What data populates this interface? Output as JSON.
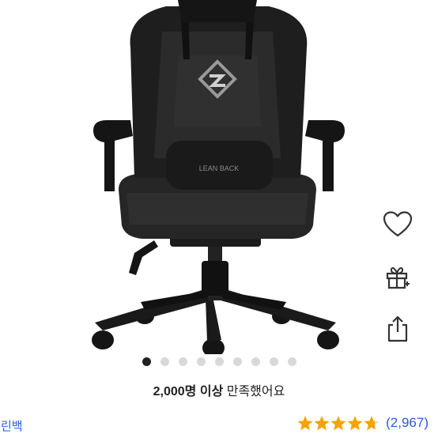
{
  "product": {
    "image_alt": "Leanback gaming chair",
    "chair_logo_text": "LEAN BACK"
  },
  "actions": {
    "wishlist_icon": "heart-icon",
    "gift_icon": "gift-icon",
    "share_icon": "share-icon"
  },
  "carousel": {
    "total": 9,
    "active_index": 0
  },
  "satisfaction": {
    "count": "2,000명 이상",
    "text": " 만족했어요"
  },
  "brand": {
    "name": "린백"
  },
  "rating": {
    "value": 4.7,
    "max": 5,
    "review_count": "(2,967)",
    "star_color": "#f5a300",
    "star_empty_color": "#dddddd"
  }
}
